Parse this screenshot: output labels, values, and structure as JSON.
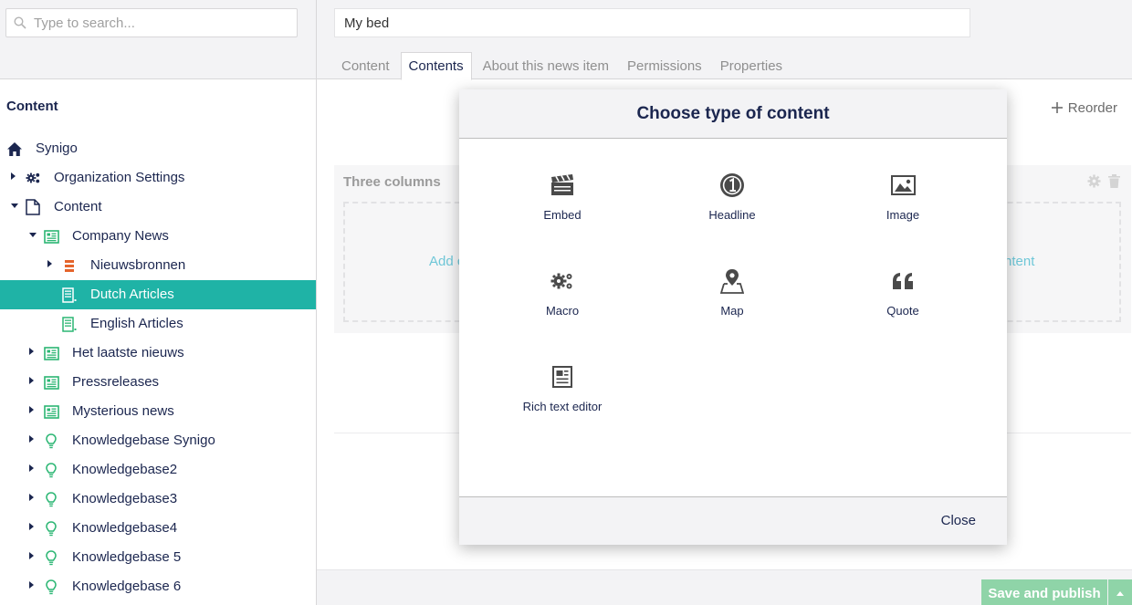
{
  "search": {
    "placeholder": "Type to search..."
  },
  "tree": {
    "title": "Content",
    "nodes": [
      {
        "label": "Synigo",
        "icon": "home-icon",
        "caret": "none",
        "depth": 0
      },
      {
        "label": "Organization Settings",
        "icon": "cogs-icon",
        "caret": "right",
        "depth": 1
      },
      {
        "label": "Content",
        "icon": "document-icon",
        "caret": "down",
        "depth": 1
      },
      {
        "label": "Company News",
        "icon": "newspaper-icon",
        "caret": "down",
        "depth": 2
      },
      {
        "label": "Nieuwsbronnen",
        "icon": "list-icon",
        "caret": "right",
        "depth": 3
      },
      {
        "label": "Dutch Articles",
        "icon": "article-icon",
        "caret": "none",
        "depth": 3,
        "selected": true
      },
      {
        "label": "English Articles",
        "icon": "article-icon",
        "caret": "none",
        "depth": 3
      },
      {
        "label": "Het laatste nieuws",
        "icon": "newspaper-icon",
        "caret": "right",
        "depth": 2
      },
      {
        "label": "Pressreleases",
        "icon": "newspaper-icon",
        "caret": "right",
        "depth": 2
      },
      {
        "label": "Mysterious news",
        "icon": "newspaper-icon",
        "caret": "right",
        "depth": 2
      },
      {
        "label": "Knowledgebase Synigo",
        "icon": "lightbulb-icon",
        "caret": "right",
        "depth": 2
      },
      {
        "label": "Knowledgebase2",
        "icon": "lightbulb-icon",
        "caret": "right",
        "depth": 2
      },
      {
        "label": "Knowledgebase3",
        "icon": "lightbulb-icon",
        "caret": "right",
        "depth": 2
      },
      {
        "label": "Knowledgebase4",
        "icon": "lightbulb-icon",
        "caret": "right",
        "depth": 2
      },
      {
        "label": "Knowledgebase 5",
        "icon": "lightbulb-icon",
        "caret": "right",
        "depth": 2
      },
      {
        "label": "Knowledgebase 6",
        "icon": "lightbulb-icon",
        "caret": "right",
        "depth": 2
      }
    ]
  },
  "editor": {
    "name_value": "My bed",
    "tabs": [
      {
        "label": "Content",
        "active": false
      },
      {
        "label": "Contents",
        "active": true
      },
      {
        "label": "About this news item",
        "active": false
      },
      {
        "label": "Permissions",
        "active": false
      },
      {
        "label": "Properties",
        "active": false
      }
    ],
    "reorder_label": "Reorder",
    "block_title": "Three columns",
    "add_left": "Add c",
    "add_right": "ntent",
    "save_label": "Save and publish"
  },
  "modal": {
    "title": "Choose type of content",
    "items": [
      {
        "label": "Embed",
        "icon": "clapperboard-icon"
      },
      {
        "label": "Headline",
        "icon": "headline-number-icon"
      },
      {
        "label": "Image",
        "icon": "image-icon"
      },
      {
        "label": "Macro",
        "icon": "cogs-icon"
      },
      {
        "label": "Map",
        "icon": "map-pin-icon"
      },
      {
        "label": "Quote",
        "icon": "quote-icon"
      },
      {
        "label": "Rich text editor",
        "icon": "rich-text-icon"
      }
    ],
    "close_label": "Close"
  },
  "colors": {
    "selected": "#1fb3a6",
    "accent_green": "#2bb673",
    "orange": "#e5642b",
    "save_button": "#8fd4a8",
    "text": "#1b264f"
  }
}
